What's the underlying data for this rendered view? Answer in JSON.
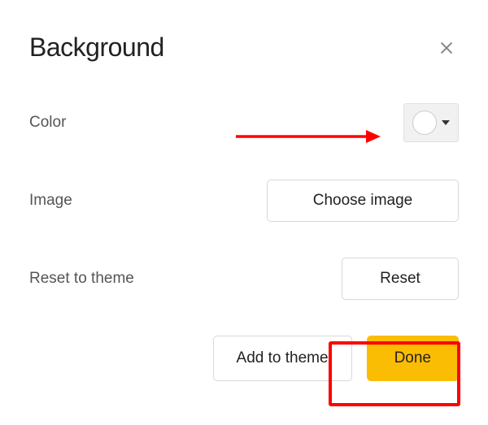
{
  "dialog": {
    "title": "Background"
  },
  "rows": {
    "color": {
      "label": "Color",
      "selected_color": "#ffffff"
    },
    "image": {
      "label": "Image",
      "button": "Choose image"
    },
    "reset": {
      "label": "Reset to theme",
      "button": "Reset"
    }
  },
  "footer": {
    "add_to_theme": "Add to theme",
    "done": "Done"
  },
  "annotations": {
    "arrow_target": "color-picker",
    "highlight_target": "done-button"
  }
}
